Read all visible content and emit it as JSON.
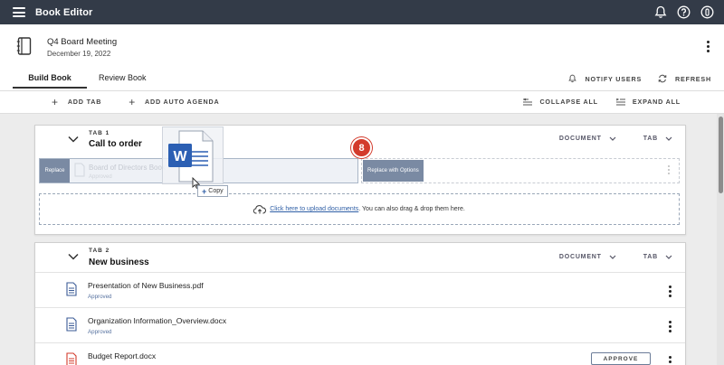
{
  "app": {
    "title": "Book Editor"
  },
  "book": {
    "title": "Q4 Board Meeting",
    "date": "December 19, 2022"
  },
  "tabs": [
    {
      "label": "Build Book"
    },
    {
      "label": "Review Book"
    }
  ],
  "header_actions": {
    "notify": "NOTIFY USERS",
    "refresh": "REFRESH"
  },
  "toolbar": {
    "add_tab": "ADD TAB",
    "add_auto_agenda": "ADD AUTO AGENDA",
    "collapse_all": "COLLAPSE ALL",
    "expand_all": "EXPAND ALL"
  },
  "sections": [
    {
      "number": "TAB 1",
      "name": "Call to order",
      "document_label": "DOCUMENT",
      "tab_label": "TAB",
      "replace_label": "Replace",
      "ghost_name": "Board of Directors Book",
      "ghost_status": "Approved",
      "replace_options_label": "Replace with Options",
      "badge": "8",
      "upload": {
        "link": "Click here to upload documents",
        "rest": ". You can also drag & drop them here."
      }
    },
    {
      "number": "TAB 2",
      "name": "New business",
      "document_label": "DOCUMENT",
      "tab_label": "TAB",
      "documents": [
        {
          "name": "Presentation of New Business.pdf",
          "status": "Approved",
          "icon_color": "#3b5b96"
        },
        {
          "name": "Organization Information_Overview.docx",
          "status": "Approved",
          "icon_color": "#3b5b96"
        },
        {
          "name": "Budget Report.docx",
          "status": "",
          "icon_color": "#d33b2c",
          "action": "APPROVE"
        }
      ]
    }
  ],
  "drag": {
    "copy_label": "Copy",
    "icon": "word-doc-icon",
    "accent": "#2b5fb3"
  }
}
